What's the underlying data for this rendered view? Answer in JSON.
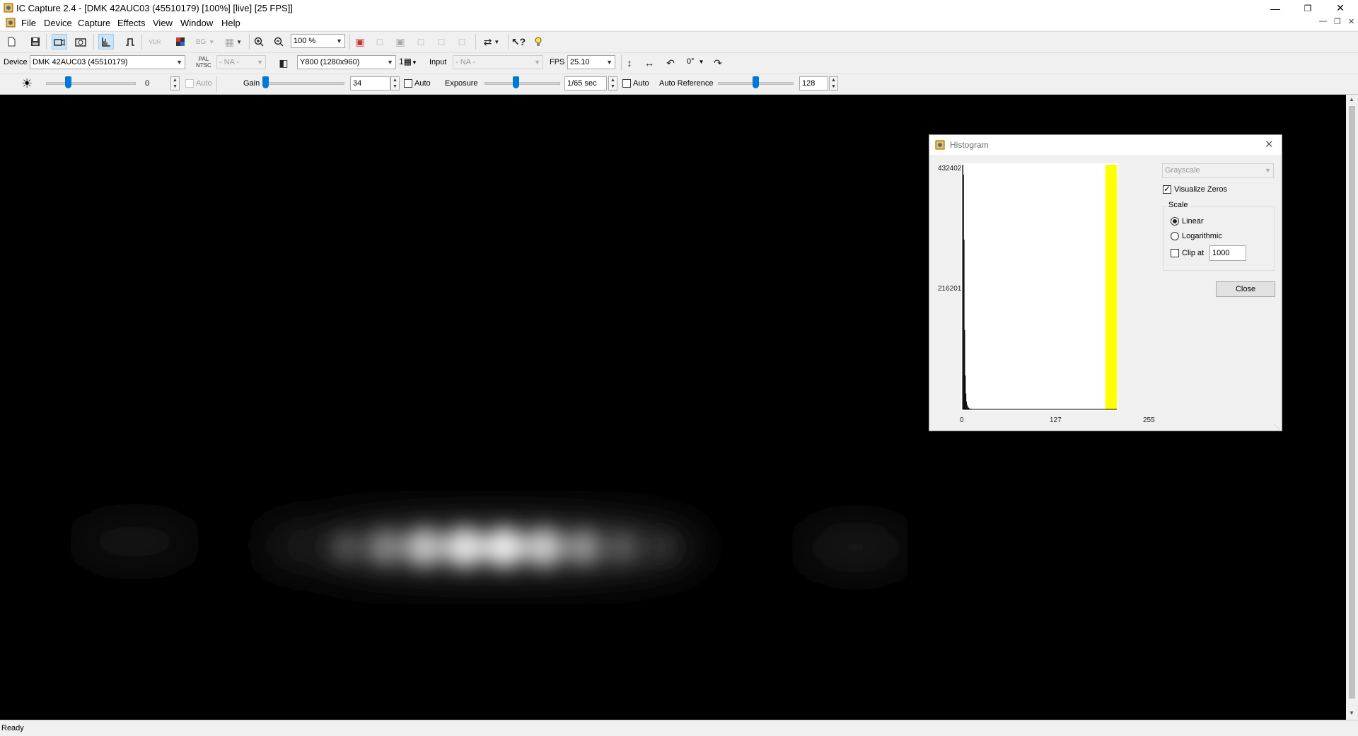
{
  "window": {
    "title": "IC Capture 2.4 - [DMK 42AUC03 (45510179) [100%]  [live]  [25 FPS]]",
    "minimize_icon": "minimize-icon",
    "restore_icon": "restore-icon",
    "close_icon": "close-icon"
  },
  "menu": {
    "items": [
      "File",
      "Device",
      "Capture",
      "Effects",
      "View",
      "Window",
      "Help"
    ]
  },
  "toolbar1": {
    "zoom_value": "100 %",
    "vdr_label": "VDR",
    "bg_label": "BG"
  },
  "toolbar2": {
    "device_label": "Device",
    "device_value": "DMK 42AUC03 (45510179)",
    "video_norm_label_top": "PAL",
    "video_norm_label_bottom": "NTSC",
    "video_norm_value": "- NA -",
    "format_value": "Y800 (1280x960)",
    "grid_count": "1",
    "input_label": "Input",
    "input_value": "- NA -",
    "fps_label": "FPS",
    "fps_value": "25.10",
    "rotation_value": "0°"
  },
  "toolbar3": {
    "brightness_value": "0",
    "brightness_auto_label": "Auto",
    "brightness_level": 0.25,
    "gain_label": "Gain",
    "gain_value": "34",
    "gain_level": 0.0,
    "gain_auto_label": "Auto",
    "exposure_label": "Exposure",
    "exposure_value": "1/65 sec",
    "exposure_level": 0.42,
    "exposure_auto_label": "Auto",
    "auto_reference_label": "Auto Reference",
    "auto_reference_value": "128",
    "auto_reference_level": 0.5
  },
  "status": {
    "text": "Ready"
  },
  "histogram": {
    "title": "Histogram",
    "channel_value": "Grayscale",
    "visualize_zeros_label": "Visualize Zeros",
    "visualize_zeros_checked": true,
    "scale_group_label": "Scale",
    "linear_label": "Linear",
    "logarithmic_label": "Logarithmic",
    "selected_scale": "Linear",
    "clip_label": "Clip at",
    "clip_value": "1000",
    "close_label": "Close",
    "colors": {
      "bars": "#000000",
      "saturation_band": "#ffff00"
    }
  },
  "chart_data": {
    "type": "bar",
    "title": "",
    "xlabel": "",
    "ylabel": "",
    "x_ticks": [
      "0",
      "127",
      "255"
    ],
    "y_ticks": [
      "432402",
      "216201"
    ],
    "xlim": [
      0,
      255
    ],
    "ylim": [
      0,
      432402
    ],
    "series": [
      {
        "x": [
          0,
          1,
          2,
          3,
          4,
          5,
          6,
          7,
          8,
          9,
          10,
          12,
          14,
          16,
          20
        ],
        "values": [
          432402,
          415000,
          300000,
          140000,
          60000,
          28000,
          14000,
          8000,
          5000,
          3500,
          2500,
          1500,
          900,
          500,
          200
        ]
      }
    ],
    "highlight_band": {
      "from": 236,
      "to": 255,
      "color": "#ffff00"
    }
  }
}
